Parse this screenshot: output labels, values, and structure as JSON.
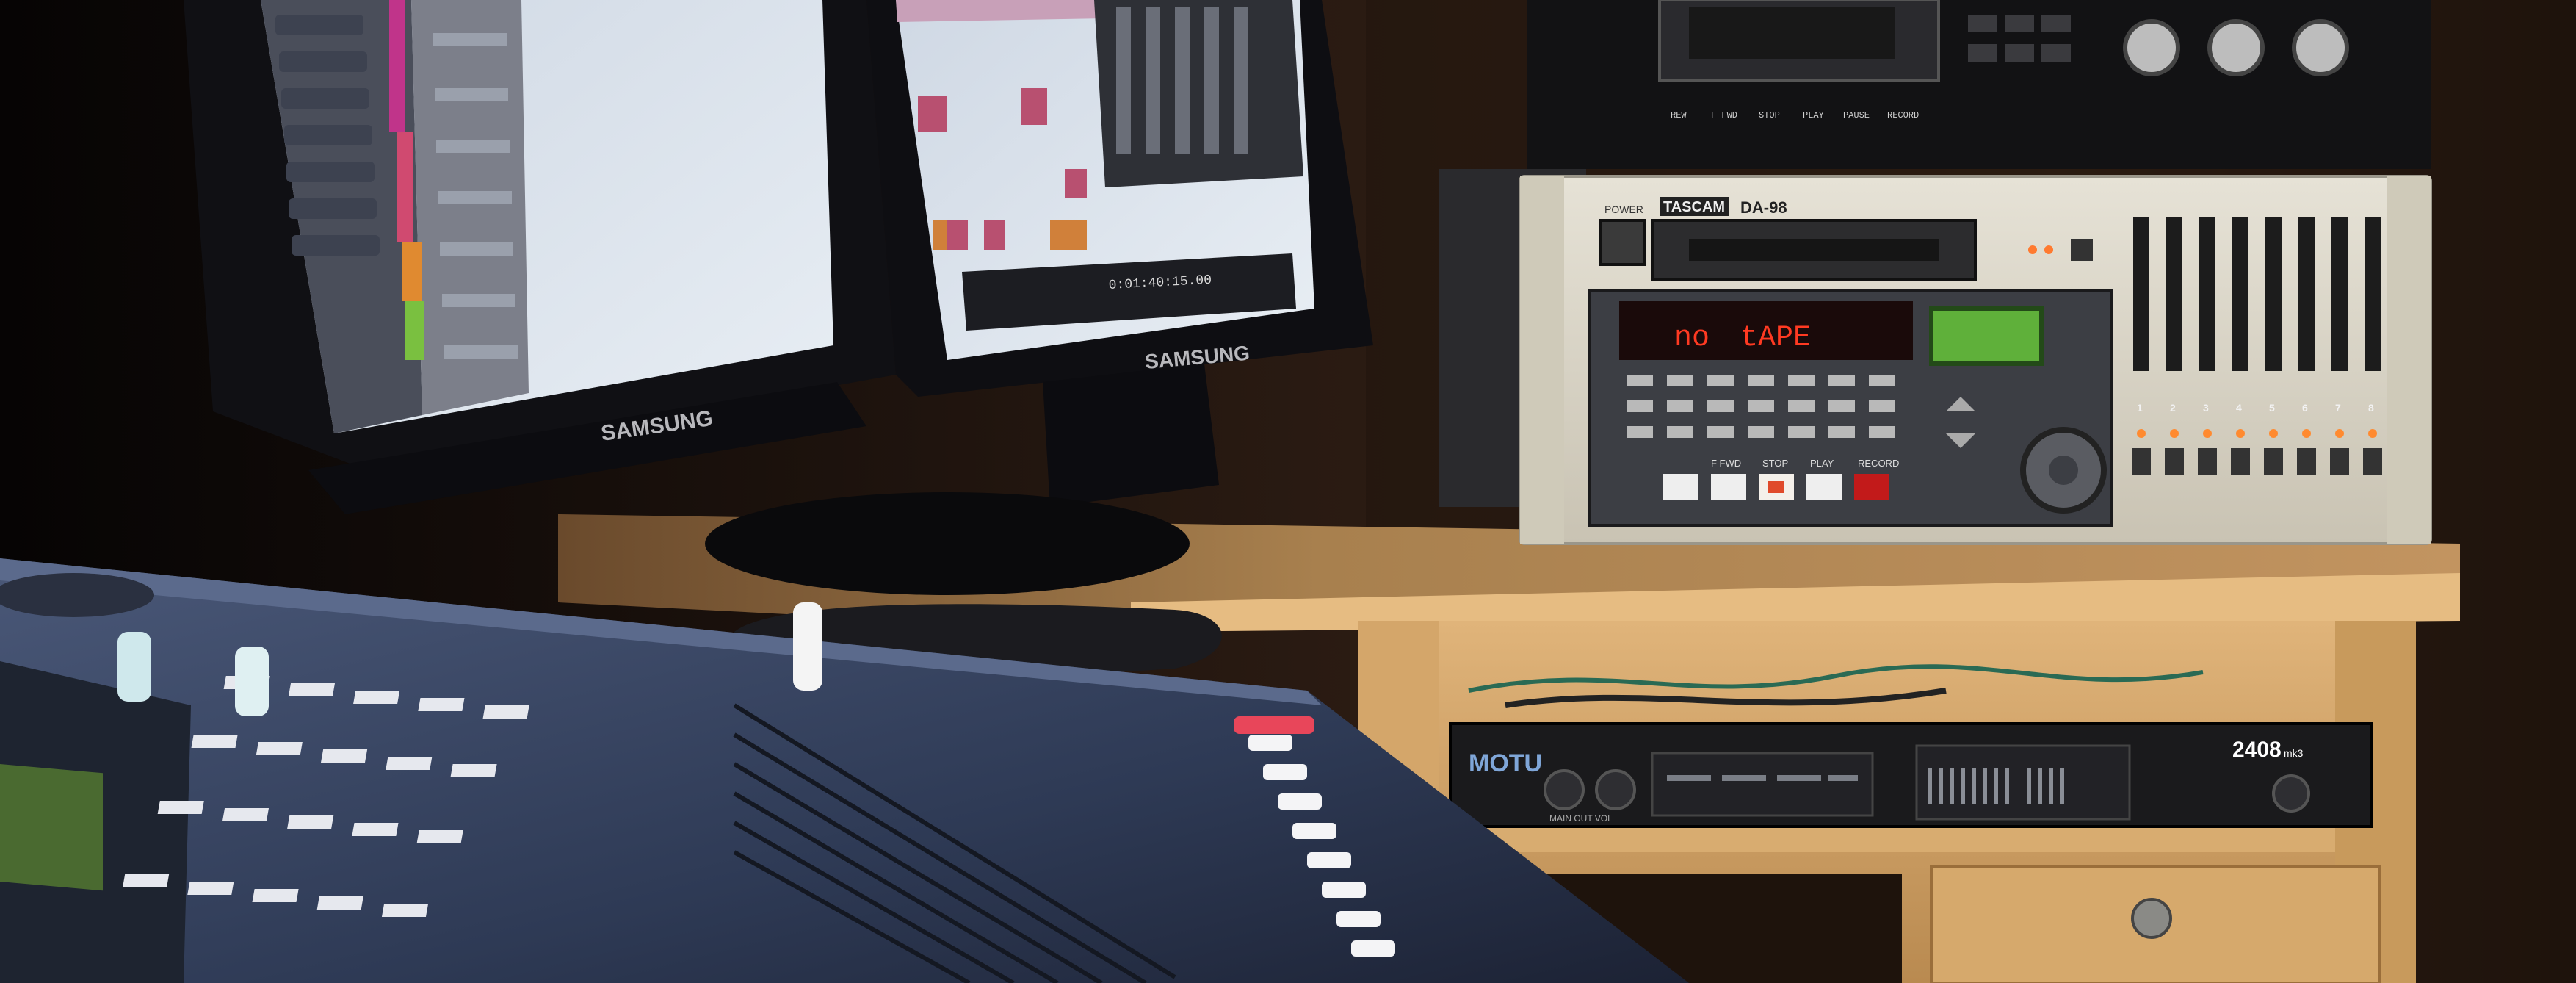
{
  "scene": {
    "subject": "home recording studio equipment",
    "colors": {
      "background": "#0a0706",
      "wall": "#2a1a12",
      "desk_wood": "#c99a5e",
      "desk_top": "#d8ac72",
      "tascam_face": "#d9d4c6",
      "motu_face": "#1a1a1c",
      "screen_light": "#dde6ef",
      "led_red": "#ff2a18",
      "lcd_green": "#5fb03a",
      "console_blue": "#3a4a68"
    }
  },
  "monitors": {
    "left_brand": "SAMSUNG",
    "right_brand": "SAMSUNG"
  },
  "tascam": {
    "brand": "TASCAM",
    "model": "DA-98",
    "power_label": "POWER",
    "display_text_1": "no",
    "display_text_2": "tAPE",
    "transport_labels": [
      "F FWD",
      "STOP",
      "PLAY",
      "RECORD"
    ],
    "track_numbers": [
      "1",
      "2",
      "3",
      "4",
      "5",
      "6",
      "7",
      "8"
    ]
  },
  "motu": {
    "brand": "MOTU",
    "model": "2408",
    "model_suffix": "mk3",
    "knob_label": "MAIN OUT VOL"
  },
  "top_deck": {
    "labels": [
      "REW",
      "F FWD",
      "STOP",
      "PLAY",
      "PAUSE",
      "RECORD"
    ]
  }
}
